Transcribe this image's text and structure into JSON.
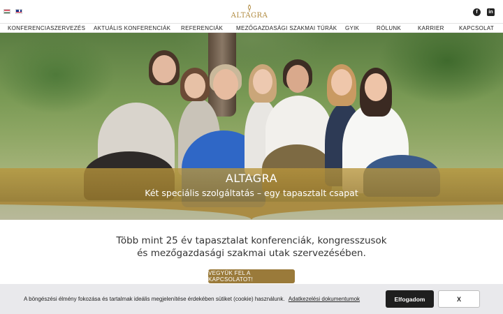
{
  "header": {
    "languages": [
      {
        "code": "hu",
        "icon": "hungarian-flag-icon"
      },
      {
        "code": "en",
        "icon": "english-flag-icon"
      }
    ],
    "logo_text": "ALTAGRA",
    "social": [
      {
        "icon": "facebook-icon",
        "glyph": "f"
      },
      {
        "icon": "linkedin-icon",
        "glyph": "in"
      }
    ]
  },
  "nav": {
    "items": [
      {
        "label": "KONFERENCIASZERVEZÉS"
      },
      {
        "label": "AKTUÁLIS KONFERENCIÁK"
      },
      {
        "label": "REFERENCIÁK"
      },
      {
        "label": "MEZŐGAZDASÁGI SZAKMAI TÚRÁK"
      },
      {
        "label": "GYIK"
      },
      {
        "label": "RÓLUNK"
      },
      {
        "label": "KARRIER"
      },
      {
        "label": "KAPCSOLAT"
      }
    ]
  },
  "hero": {
    "title": "ALTAGRA",
    "subtitle": "Két speciális szolgáltatás – egy tapasztalt csapat",
    "band_color": "#b0903e"
  },
  "main": {
    "lead_line1": "Több mint 25 év tapasztalat konferenciák, kongresszusok",
    "lead_line2": "és mezőgazdasági szakmai utak szervezésében.",
    "cta_label": "VEGYÜK FEL A KAPCSOLATOT!"
  },
  "cookie_bar": {
    "text": "A böngészési élmény fokozása és tartalmak ideális megjelenítése érdekében sütiket (cookie) használunk.",
    "link": "Adatkezelési dokumentumok",
    "accept_label": "Elfogadom",
    "close_label": "X"
  },
  "colors": {
    "accent": "#9a7a3a",
    "logo": "#b08a3e",
    "cookie_bg": "#e9e9ec"
  }
}
